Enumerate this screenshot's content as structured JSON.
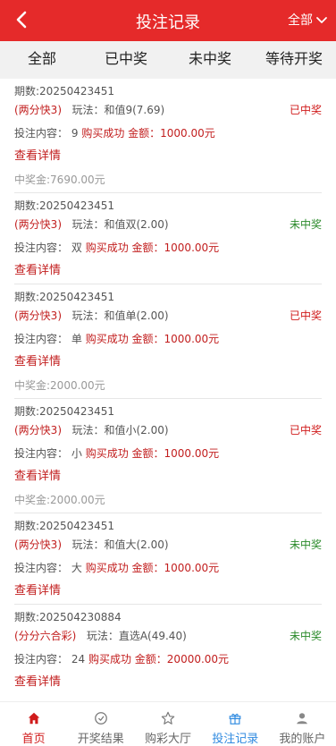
{
  "header": {
    "title": "投注记录",
    "filter_label": "全部"
  },
  "tabs": [
    {
      "label": "全部"
    },
    {
      "label": "已中奖"
    },
    {
      "label": "未中奖"
    },
    {
      "label": "等待开奖"
    }
  ],
  "records": [
    {
      "period": "期数:20250423451",
      "game": "(两分快3)",
      "play": "玩法：和值9(7.69)",
      "status": "已中奖",
      "content_label": "投注内容：",
      "content_value": "9",
      "success": "购买成功",
      "amount": "金额：1000.00元",
      "detail": "查看详情",
      "prize": "中奖金:7690.00元"
    },
    {
      "period": "期数:20250423451",
      "game": "(两分快3)",
      "play": "玩法：和值双(2.00)",
      "status": "未中奖",
      "content_label": "投注内容：",
      "content_value": "双",
      "success": "购买成功",
      "amount": "金额：1000.00元",
      "detail": "查看详情",
      "prize": ""
    },
    {
      "period": "期数:20250423451",
      "game": "(两分快3)",
      "play": "玩法：和值单(2.00)",
      "status": "已中奖",
      "content_label": "投注内容：",
      "content_value": "单",
      "success": "购买成功",
      "amount": "金额：1000.00元",
      "detail": "查看详情",
      "prize": "中奖金:2000.00元"
    },
    {
      "period": "期数:20250423451",
      "game": "(两分快3)",
      "play": "玩法：和值小(2.00)",
      "status": "已中奖",
      "content_label": "投注内容：",
      "content_value": "小",
      "success": "购买成功",
      "amount": "金额：1000.00元",
      "detail": "查看详情",
      "prize": "中奖金:2000.00元"
    },
    {
      "period": "期数:20250423451",
      "game": "(两分快3)",
      "play": "玩法：和值大(2.00)",
      "status": "未中奖",
      "content_label": "投注内容：",
      "content_value": "大",
      "success": "购买成功",
      "amount": "金额：1000.00元",
      "detail": "查看详情",
      "prize": ""
    },
    {
      "period": "期数:202504230884",
      "game": "(分分六合彩)",
      "play": "玩法：直选A(49.40)",
      "status": "未中奖",
      "content_label": "投注内容：",
      "content_value": "24",
      "success": "购买成功",
      "amount": "金额：20000.00元",
      "detail": "查看详情",
      "prize": ""
    }
  ],
  "nav": [
    {
      "label": "首页",
      "icon": "home-icon"
    },
    {
      "label": "开奖结果",
      "icon": "results-icon"
    },
    {
      "label": "购彩大厅",
      "icon": "lobby-icon"
    },
    {
      "label": "投注记录",
      "icon": "gift-icon"
    },
    {
      "label": "我的账户",
      "icon": "account-icon"
    }
  ],
  "colors": {
    "header_bg": "#e52a2a",
    "won": "#d01b1b",
    "lost": "#2a8a2a",
    "active_nav": "#2f8ae0"
  }
}
